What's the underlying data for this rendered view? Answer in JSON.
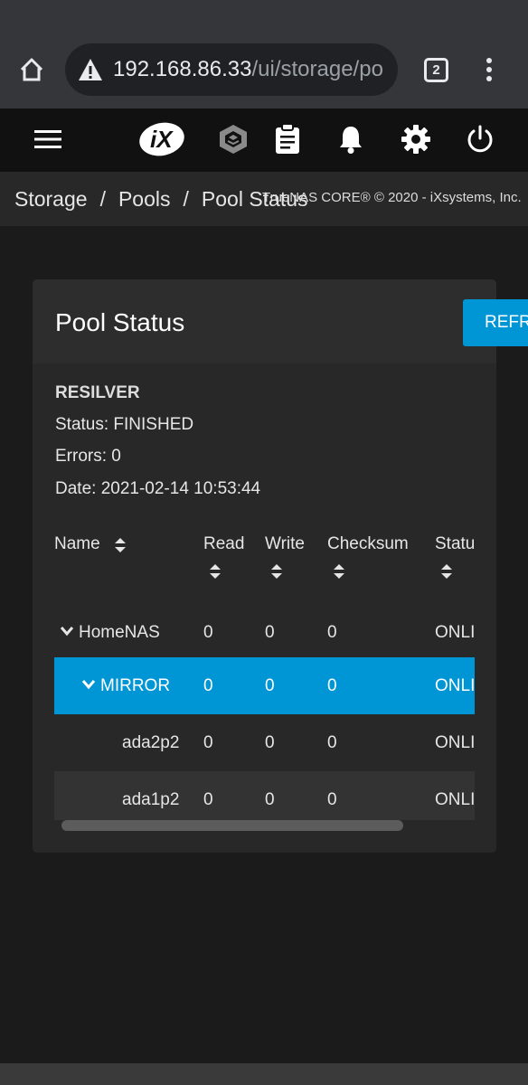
{
  "browser": {
    "url_host": "192.168.86.33",
    "url_path": "/ui/storage/po",
    "tab_count": "2"
  },
  "toolbar": {
    "icons": [
      "menu-icon",
      "ix-logo",
      "truecommand-icon",
      "clipboard-icon",
      "bell-icon",
      "gear-icon",
      "power-icon"
    ]
  },
  "breadcrumb": {
    "items": [
      "Storage",
      "Pools",
      "Pool Status"
    ],
    "separator": "/"
  },
  "copyright": "TrueNAS CORE® © 2020 - iXsystems, Inc.",
  "card": {
    "title": "Pool Status",
    "refresh_label": "REFRESH"
  },
  "scan": {
    "type": "RESILVER",
    "status": "Status: FINISHED",
    "errors": "Errors: 0",
    "date": "Date: 2021-02-14 10:53:44"
  },
  "table": {
    "columns": [
      "Name",
      "Read",
      "Write",
      "Checksum",
      "Status"
    ],
    "rows": [
      {
        "name": "HomeNAS",
        "read": "0",
        "write": "0",
        "checksum": "0",
        "status": "ONLINE"
      },
      {
        "name": "MIRROR",
        "read": "0",
        "write": "0",
        "checksum": "0",
        "status": "ONLINE"
      },
      {
        "name": "ada2p2",
        "read": "0",
        "write": "0",
        "checksum": "0",
        "status": "ONLINE"
      },
      {
        "name": "ada1p2",
        "read": "0",
        "write": "0",
        "checksum": "0",
        "status": "ONLINE"
      }
    ]
  },
  "colors": {
    "accent": "#0095d5",
    "toolbar": "#111111",
    "card": "#282828",
    "background": "#1b1b1b"
  }
}
